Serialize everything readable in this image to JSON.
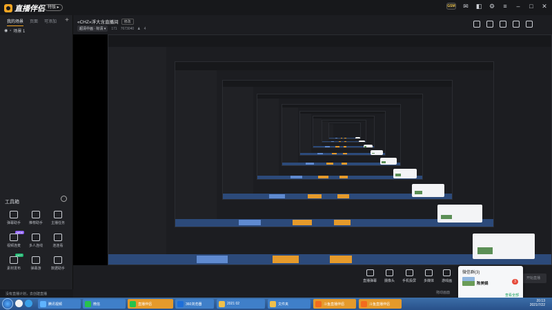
{
  "app": {
    "logo_text": "直播伴侣",
    "version_badge": "特版 ▸",
    "avatar_text": "GSM"
  },
  "left": {
    "tabs": [
      "我的场景",
      "页面",
      "可添加"
    ],
    "scene_name": "场景 1",
    "toolbox_title": "工具箱",
    "tools": [
      {
        "icon": "pop-icon",
        "label": "弹幕助手",
        "badge": ""
      },
      {
        "icon": "anchor-icon",
        "label": "推荐助手",
        "badge": ""
      },
      {
        "icon": "task-icon",
        "label": "主播任务",
        "badge": ""
      },
      {
        "icon": "video-icon",
        "label": "视频连麦",
        "badge": "NEW"
      },
      {
        "icon": "multi-icon",
        "label": "多人连线",
        "badge": ""
      },
      {
        "icon": "pk-icon",
        "label": "连连看",
        "badge": ""
      },
      {
        "icon": "upload-icon",
        "label": "素材发布",
        "badge": "HOT"
      },
      {
        "icon": "game-icon",
        "label": "弹幕游",
        "badge": ""
      },
      {
        "icon": "data-icon",
        "label": "数据助手",
        "badge": ""
      }
    ],
    "footer": "没有直播计划，去创建直播"
  },
  "header": {
    "title": "«CHZ»浮大含直播间",
    "edit_label": "修改",
    "quality": "超清中画 · 标清 ▾",
    "room_id": "171",
    "followers": "7673040",
    "viewers": "4"
  },
  "actions": [
    "直播弹幕",
    "摄像头",
    "手机投屏",
    "多媒体",
    "游戏画"
  ],
  "start_button": "开始直播",
  "drop_label": "拖动画面",
  "popup": {
    "title": "微信群(3)",
    "name": "陈美娟",
    "count": "3",
    "link": "查看全部"
  },
  "taskbar": {
    "tasks": [
      "腾讯视频",
      "微信",
      "直播伴侣",
      "360浏览器",
      "2021 02",
      "文件夹",
      "斗鱼直播伴侣",
      "斗鱼直播伴侣"
    ],
    "time": "20:13",
    "date": "2021/7/22"
  },
  "colors": {
    "accent": "#f5a623",
    "taskbar": "#2c5a96"
  }
}
